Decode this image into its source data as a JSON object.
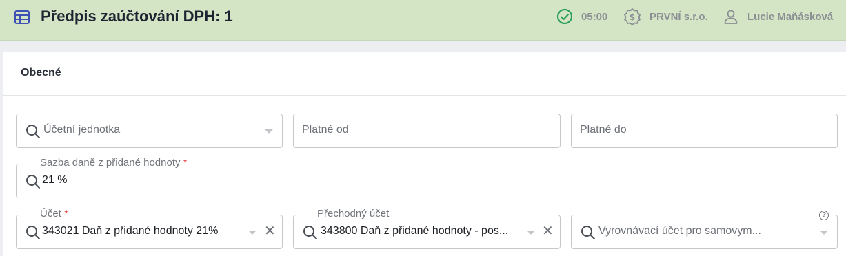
{
  "header": {
    "title": "Předpis zaúčtování DPH: 1",
    "time": "05:00",
    "company": "PRVNÍ s.r.o.",
    "user": "Lucie Maňásková",
    "title_icon": "table-icon",
    "status_icon": "check-circle-icon",
    "company_icon": "money-badge-icon",
    "user_icon": "user-icon",
    "accent_color": "#3f51b5",
    "success_color": "#2e9e5b"
  },
  "section": {
    "title": "Obecné"
  },
  "form": {
    "accounting_unit": {
      "placeholder": "Účetní jednotka"
    },
    "valid_from": {
      "placeholder": "Platné od"
    },
    "valid_to": {
      "placeholder": "Platné do"
    },
    "vat_rate": {
      "label": "Sazba daně z přidané hodnoty",
      "required_mark": "*",
      "value": "21 %"
    },
    "account": {
      "label": "Účet",
      "required_mark": "*",
      "value": "343021 Daň z přidané hodnoty 21%"
    },
    "transit_account": {
      "label": "Přechodný účet",
      "value": "343800 Daň z přidané hodnoty - pos..."
    },
    "balancing_account": {
      "placeholder": "Vyrovnávací účet pro samovym...",
      "help_mark": "?"
    },
    "clear_symbol": "✕"
  }
}
